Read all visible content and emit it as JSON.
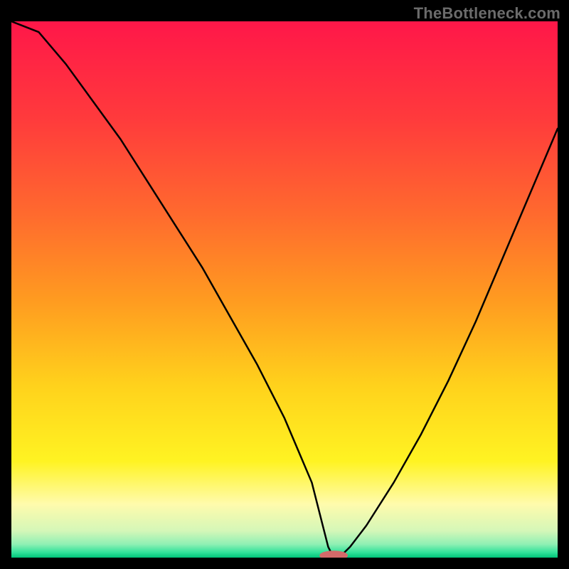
{
  "credit": "TheBottleneck.com",
  "chart_data": {
    "type": "line",
    "title": "",
    "xlabel": "",
    "ylabel": "",
    "xlim": [
      0,
      100
    ],
    "ylim": [
      0,
      100
    ],
    "grid": false,
    "legend": false,
    "x": [
      0,
      5,
      10,
      15,
      20,
      25,
      30,
      35,
      40,
      45,
      50,
      55,
      57,
      58,
      59,
      60,
      62,
      65,
      70,
      75,
      80,
      85,
      90,
      95,
      100
    ],
    "y": [
      100,
      98,
      92,
      85,
      78,
      70,
      62,
      54,
      45,
      36,
      26,
      14,
      6,
      2,
      0,
      0,
      2,
      6,
      14,
      23,
      33,
      44,
      56,
      68,
      80
    ],
    "marker": {
      "x": 59,
      "y": 0.4,
      "rx": 2.6,
      "ry": 0.9
    },
    "gradient_stops": [
      {
        "offset": 0.0,
        "color": "#ff1749"
      },
      {
        "offset": 0.18,
        "color": "#ff3a3c"
      },
      {
        "offset": 0.36,
        "color": "#ff6a2e"
      },
      {
        "offset": 0.52,
        "color": "#ff9b20"
      },
      {
        "offset": 0.68,
        "color": "#ffd21c"
      },
      {
        "offset": 0.82,
        "color": "#fff322"
      },
      {
        "offset": 0.9,
        "color": "#fffbac"
      },
      {
        "offset": 0.95,
        "color": "#d5f7b8"
      },
      {
        "offset": 0.975,
        "color": "#8ff0b4"
      },
      {
        "offset": 0.99,
        "color": "#33e29a"
      },
      {
        "offset": 1.0,
        "color": "#00c47a"
      }
    ],
    "marker_color": "#d46a6a"
  }
}
